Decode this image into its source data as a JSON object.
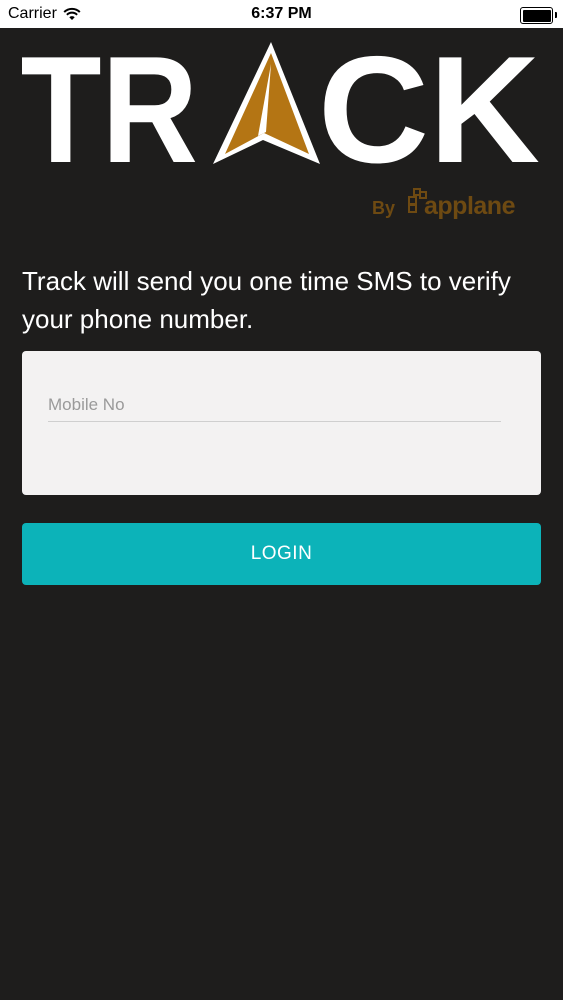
{
  "status_bar": {
    "carrier": "Carrier",
    "time": "6:37 PM"
  },
  "logo": {
    "text_left": "TR",
    "text_right": "CK",
    "byline_by": "By",
    "byline_brand": "applane",
    "accent_color": "#b47514"
  },
  "intro": {
    "message": "Track will send you one time SMS to verify your phone number."
  },
  "form": {
    "mobile_placeholder": "Mobile No",
    "mobile_value": ""
  },
  "login_button": {
    "label": "LOGIN",
    "color": "#0cb3b9"
  }
}
